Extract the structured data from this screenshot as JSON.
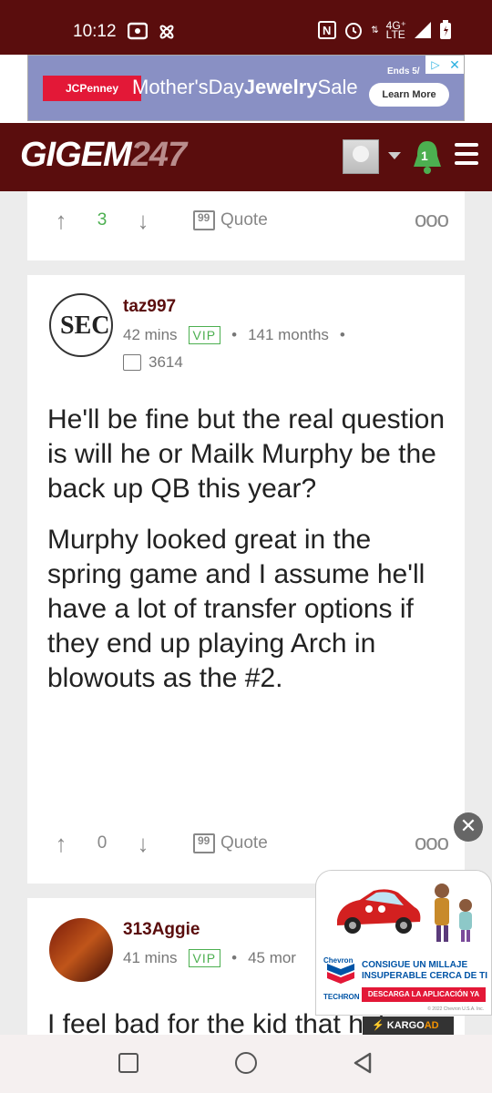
{
  "status_bar": {
    "time": "10:12",
    "network": "4G⁺",
    "network_sub": "LTE"
  },
  "top_ad": {
    "brand": "JCPenney",
    "headline_pre": "Mother'sDay",
    "headline_bold": "Jewelry",
    "headline_post": "Sale",
    "ends": "Ends 5/",
    "cta": "Learn More",
    "close": "✕"
  },
  "header": {
    "logo_text": "GIGEM",
    "logo_num": "247",
    "notification_count": "1"
  },
  "posts": [
    {
      "upvotes": "3",
      "quote_label": "Quote",
      "more": "ooo"
    },
    {
      "username": "taz997",
      "time": "42 mins",
      "badge": "VIP",
      "tenure": "141 months",
      "message_count": "3614",
      "body": [
        "He'll be fine but the real question is will he or Mailk Murphy be the back up QB this year?",
        "Murphy looked great in the spring game and I assume he'll have a lot of transfer options if they end up playing Arch in blowouts as the #2."
      ],
      "upvotes": "0",
      "quote_label": "Quote",
      "more": "ooo",
      "avatar_text": "SEC"
    },
    {
      "username": "313Aggie",
      "time": "41 mins",
      "badge": "VIP",
      "tenure": "45 mor",
      "body_partial": "I feel bad for the kid that he's"
    }
  ],
  "floating_ad": {
    "brand": "Chevron",
    "headline": "CONSIGUE UN MILLAJE INSUPERABLE CERCA DE TI",
    "cta": "DESCARGA LA APLICACIÓN YA",
    "sub_brand": "TECHRON",
    "legal": "© 2022 Chevron U.S.A. Inc.",
    "close": "✕",
    "provider_prefix": "⚡ ",
    "provider_main": "KARGO",
    "provider_suffix": "AD"
  },
  "colors": {
    "header_bg": "#5a0d0d",
    "username": "#5a0d0d",
    "vip_green": "#4caf50",
    "upvote_green": "#4caf50"
  }
}
